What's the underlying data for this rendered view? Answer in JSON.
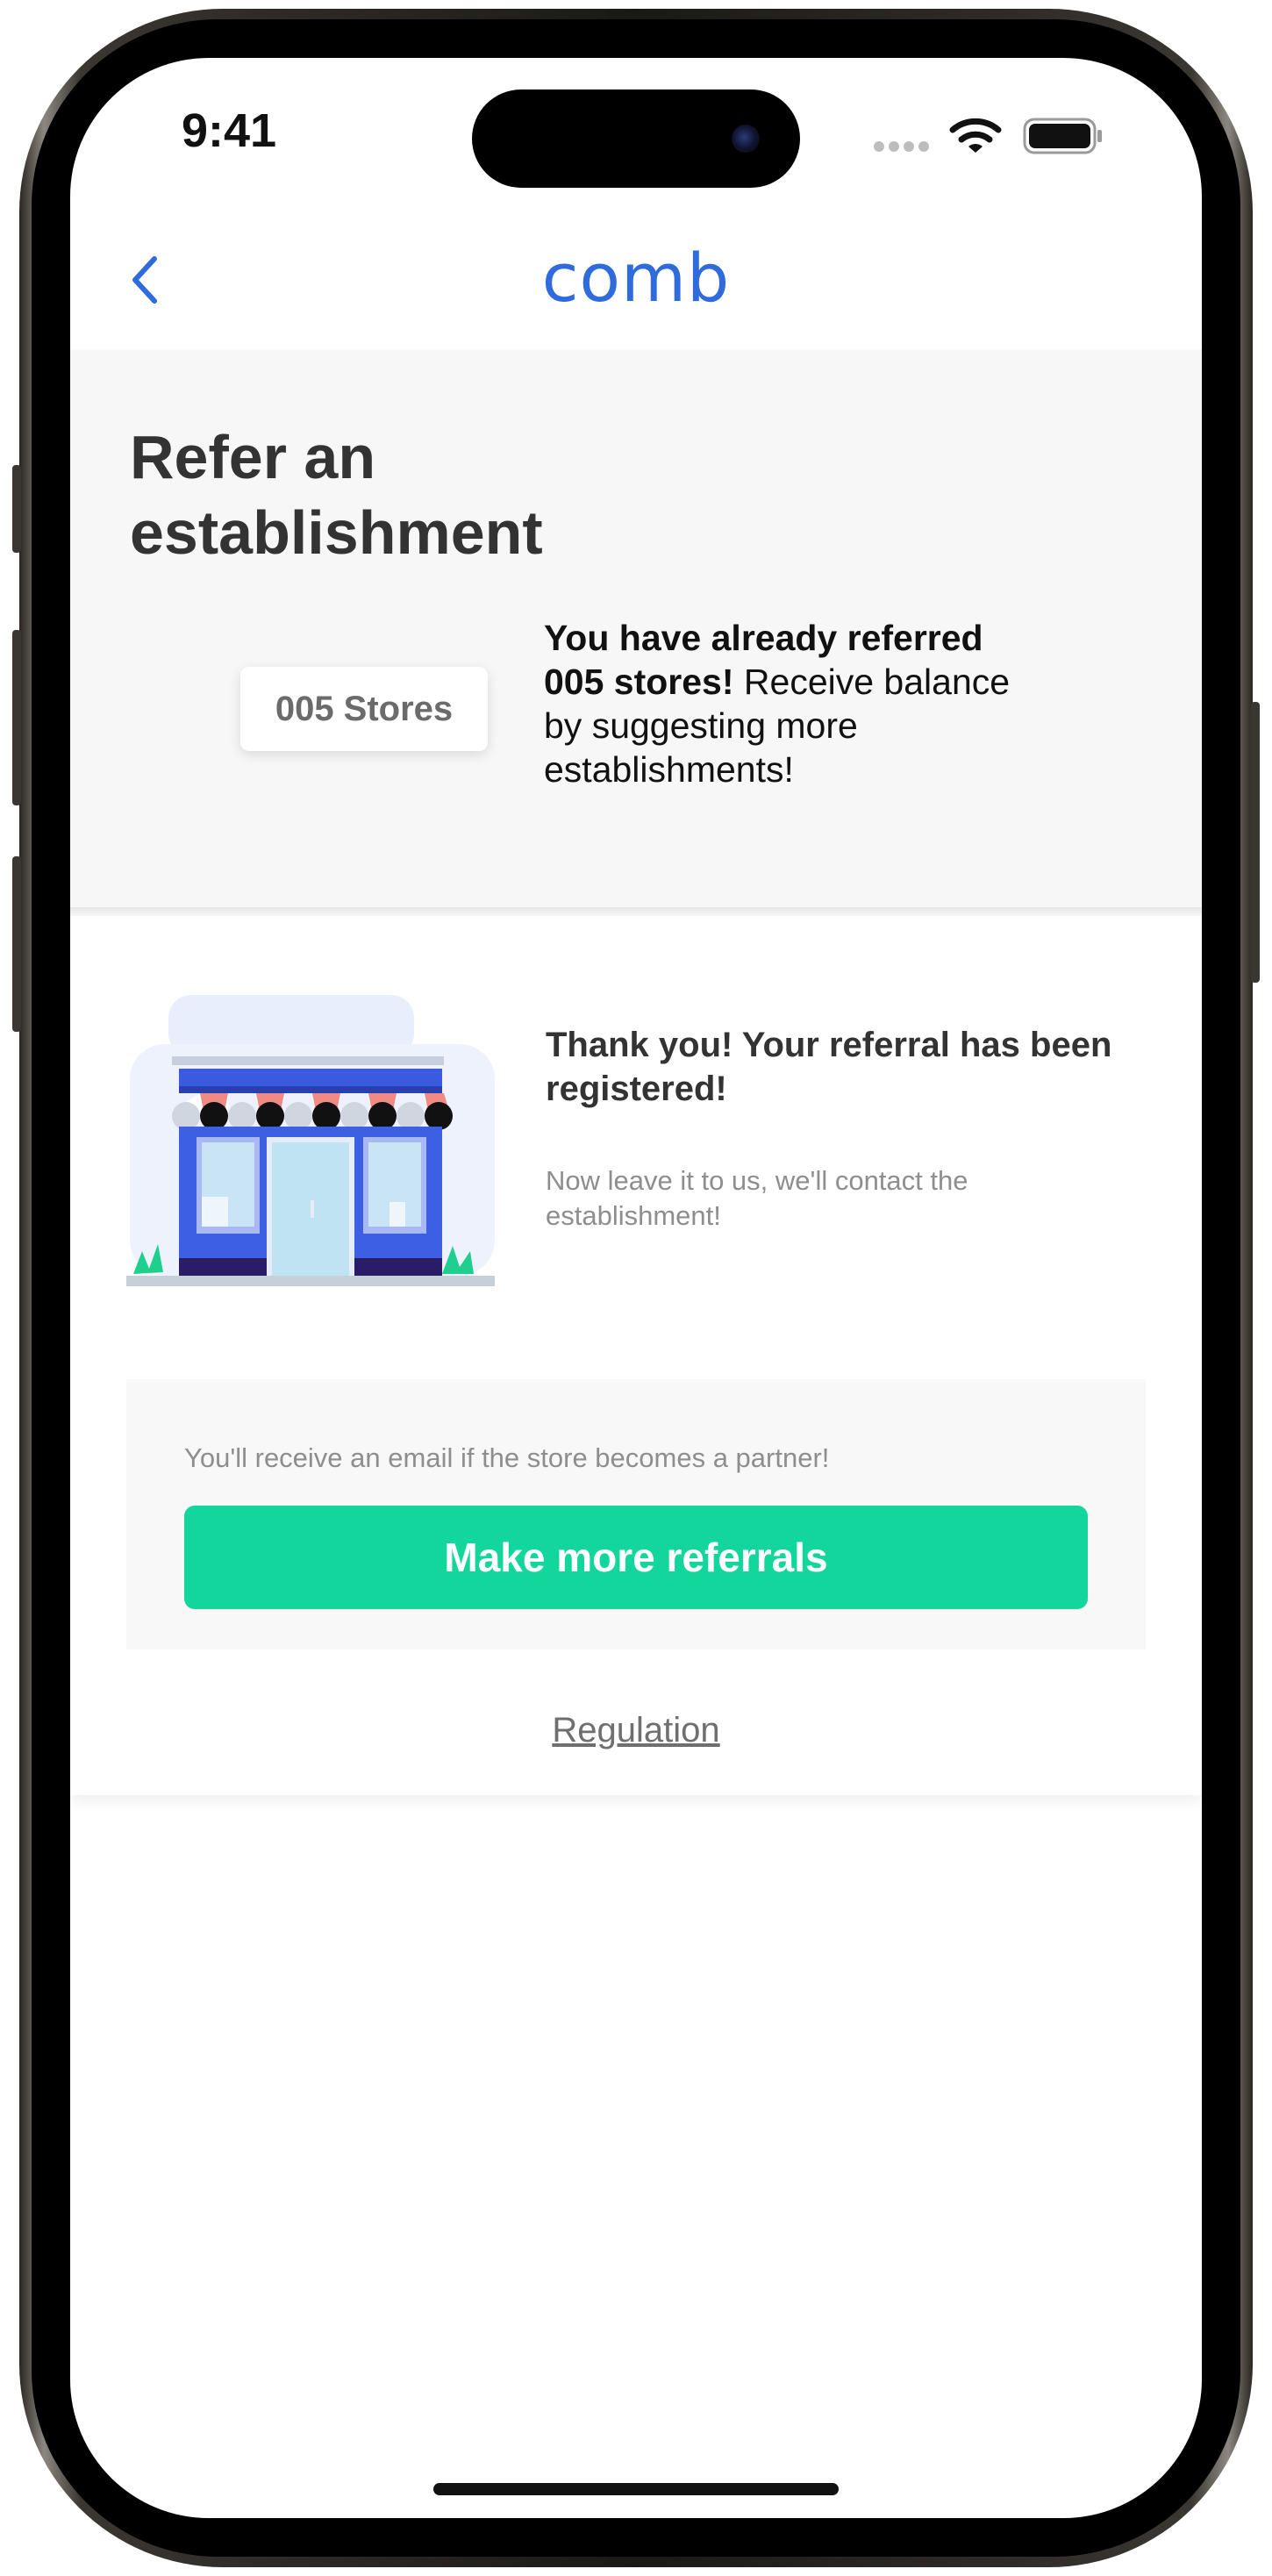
{
  "status_bar": {
    "time": "9:41"
  },
  "header": {
    "logo": "comb"
  },
  "page": {
    "title": "Refer an establishment"
  },
  "summary": {
    "badge": "005 Stores",
    "bold_text": "You have already referred 005 stores!",
    "rest_text": " Receive balance by suggesting more establishments!"
  },
  "confirmation": {
    "title": "Thank you! Your referral has been registered!",
    "subtitle": "Now leave it to us, we'll contact the establishment!"
  },
  "cta": {
    "note": "You'll receive an email if the store becomes a partner!",
    "button_label": "Make more referrals"
  },
  "footer": {
    "regulation_label": "Regulation"
  },
  "colors": {
    "brand": "#2f6bdd",
    "cta": "#12d69c"
  }
}
